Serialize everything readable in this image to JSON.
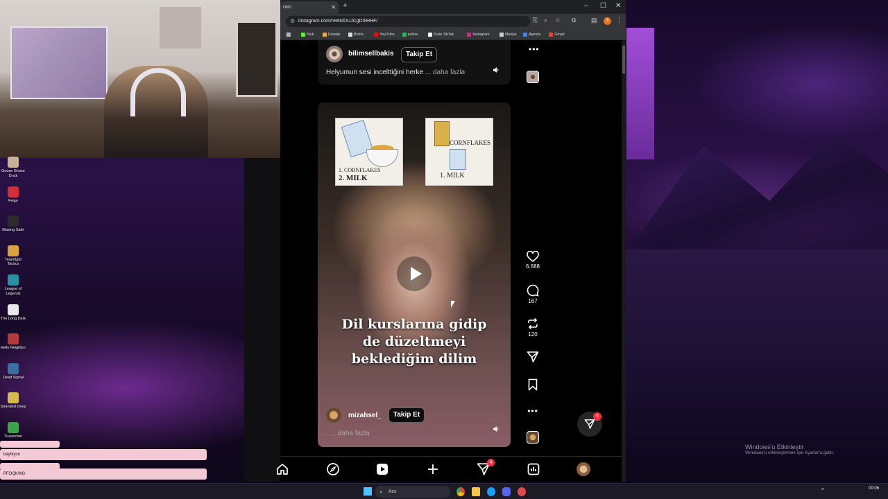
{
  "browser": {
    "tab_title": "ram",
    "url": "instagram.com/reels/DUJCgD0iHHF/",
    "profile_initial": "S",
    "bookmarks": [
      "Kick",
      "Donate",
      "Botrix",
      "YouTube",
      "sulina",
      "Sulin TikTok",
      "Instagram",
      "Medya",
      "Ajanda",
      "Gmail"
    ],
    "bookmark_colors": [
      "#53fc18",
      "#f5a623",
      "#dddddd",
      "#ff0000",
      "#1db954",
      "#ffffff",
      "#d62976",
      "#cccccc",
      "#4285f4",
      "#ea4335"
    ]
  },
  "reel_top": {
    "username": "bilimsellbakis",
    "follow_label": "Takip Et",
    "caption": "Helyumun sesi incelttiğini herke",
    "more_label": "... daha fazla"
  },
  "reel_main": {
    "image_left": {
      "line1": "1. CORNFLAKES",
      "line2": "2. MILK"
    },
    "image_right": {
      "line1": "CORNFLAKES",
      "line2": "1. MILK"
    },
    "overlay_lines": [
      "Dil kurslarına gidip",
      "de düzeltmeyi",
      "beklediğim dilim"
    ],
    "username": "mizahsel_",
    "follow_label": "Takip Et",
    "caption": ". ... daha fazla",
    "likes": "6.688",
    "comments": "167",
    "reposts": "120"
  },
  "fab_badge": "4",
  "nav_badge": "4",
  "desktop_icons": [
    {
      "label": "Goose Goose Duck",
      "color": "#c7b299"
    },
    {
      "label": "Feign",
      "color": "#d0303a"
    },
    {
      "label": "Blazing Sails",
      "color": "#2b2b2b"
    },
    {
      "label": "Teamfight Tactics",
      "color": "#d8a43b"
    },
    {
      "label": "League of Legends",
      "color": "#2a8fa0"
    },
    {
      "label": "The Long Dark",
      "color": "#e7e7e7"
    },
    {
      "label": "Hello Neighbor",
      "color": "#b33b3b"
    },
    {
      "label": "Dead Signal",
      "color": "#3a6fa0"
    },
    {
      "label": "Stranded Deep",
      "color": "#d7b84e"
    },
    {
      "label": "TLauncher",
      "color": "#3da34a"
    }
  ],
  "chat": [
    "baybiyon",
    "PFOQKWG"
  ],
  "watermark": {
    "title": "Windows'u Etkinleştir",
    "sub": "Windows'u etkinleştirmek için Ayarlar'a gidin."
  },
  "taskbar": {
    "search_label": "Ara",
    "time": "00:06"
  }
}
